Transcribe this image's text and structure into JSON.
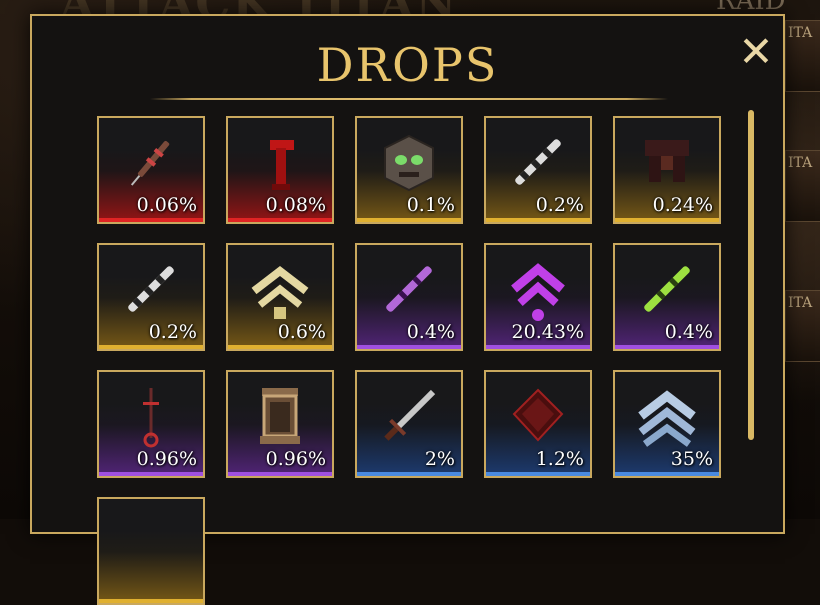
{
  "background": {
    "title": "ATTACK TITAN",
    "raid": "RAID",
    "card_label": "ITA"
  },
  "dialog": {
    "title": "DROPS",
    "close": "✕"
  },
  "drops": [
    {
      "icon": "syringe-icon",
      "pct": "0.06%",
      "rarity": "red"
    },
    {
      "icon": "red-banner-icon",
      "pct": "0.08%",
      "rarity": "red"
    },
    {
      "icon": "titan-head-icon",
      "pct": "0.1%",
      "rarity": "gold"
    },
    {
      "icon": "blade-handle-icon",
      "pct": "0.2%",
      "rarity": "gold"
    },
    {
      "icon": "dark-armor-icon",
      "pct": "0.24%",
      "rarity": "gold"
    },
    {
      "icon": "blade-handle-icon",
      "pct": "0.2%",
      "rarity": "gold"
    },
    {
      "icon": "rank-chevron-icon",
      "pct": "0.6%",
      "rarity": "gold"
    },
    {
      "icon": "purple-blade-icon",
      "pct": "0.4%",
      "rarity": "purple"
    },
    {
      "icon": "purple-chevron-icon",
      "pct": "20.43%",
      "rarity": "purple"
    },
    {
      "icon": "green-blade-icon",
      "pct": "0.4%",
      "rarity": "purple"
    },
    {
      "icon": "key-icon",
      "pct": "0.96%",
      "rarity": "purple"
    },
    {
      "icon": "lantern-icon",
      "pct": "0.96%",
      "rarity": "purple"
    },
    {
      "icon": "sword-icon",
      "pct": "2%",
      "rarity": "blue"
    },
    {
      "icon": "red-crystal-icon",
      "pct": "1.2%",
      "rarity": "blue"
    },
    {
      "icon": "blue-chevron-icon",
      "pct": "35%",
      "rarity": "blue"
    },
    {
      "icon": "",
      "pct": "",
      "rarity": "gold"
    }
  ]
}
